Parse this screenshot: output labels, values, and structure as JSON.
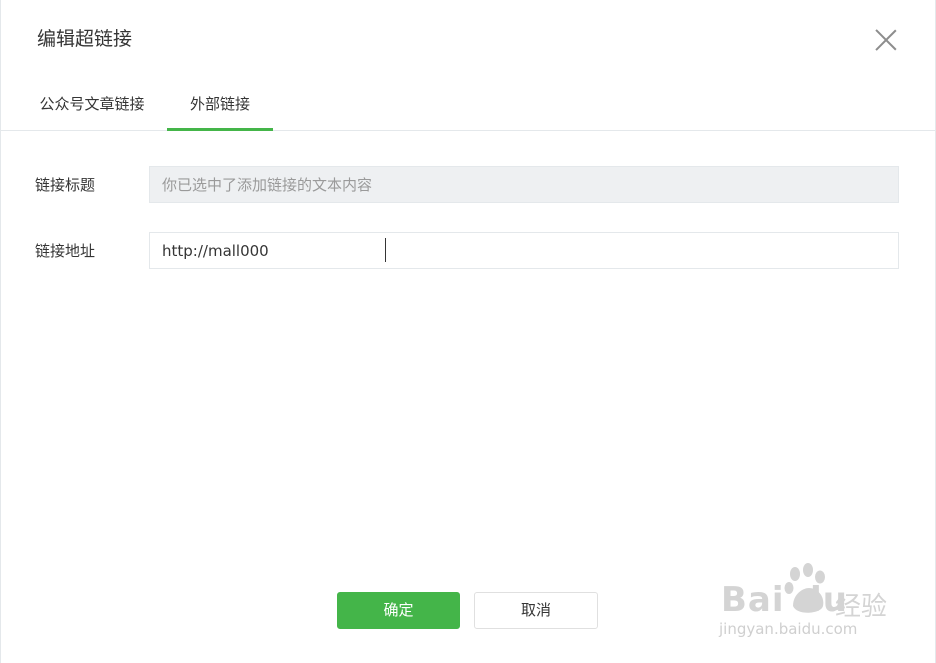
{
  "dialog": {
    "title": "编辑超链接",
    "close_icon": "close-icon"
  },
  "tabs": [
    {
      "label": "公众号文章链接",
      "active": false
    },
    {
      "label": "外部链接",
      "active": true
    }
  ],
  "form": {
    "title_label": "链接标题",
    "title_placeholder": "你已选中了添加链接的文本内容",
    "url_label": "链接地址",
    "url_value": "http://mall000"
  },
  "actions": {
    "confirm_label": "确定",
    "cancel_label": "取消"
  },
  "watermark": {
    "logo_text": "Bai du",
    "brand_text": "经验",
    "url_text": "jingyan.baidu.com"
  },
  "colors": {
    "accent": "#44b549",
    "text": "#353535",
    "border": "#e4e8eb",
    "disabled_bg": "#eef0f2"
  }
}
